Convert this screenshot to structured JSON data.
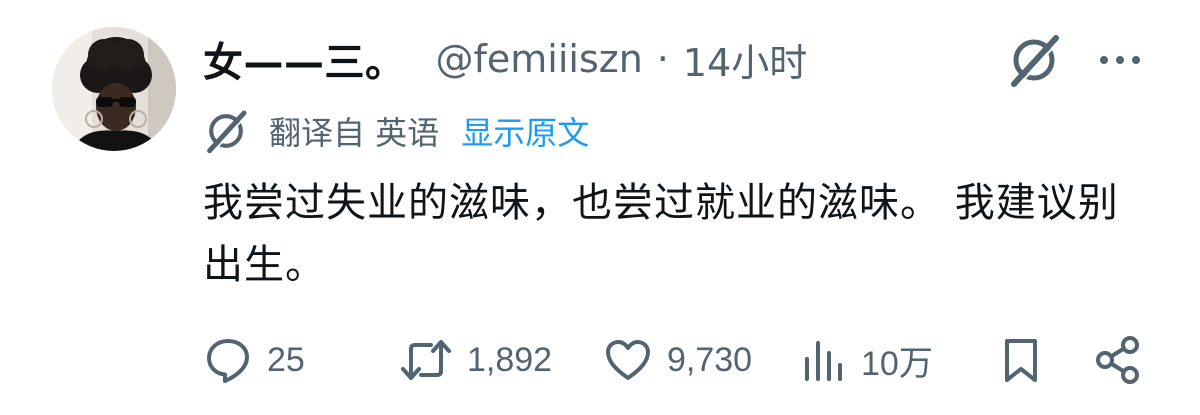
{
  "author": {
    "display_name": "女——三。",
    "handle": "@femiiiszn",
    "separator": "·",
    "time": "14小时"
  },
  "icons": {
    "grok": "grok-icon",
    "more": "more-dots-icon",
    "translate": "grok-translate-icon",
    "reply": "reply-bubble-icon",
    "retweet": "retweet-icon",
    "like": "heart-icon",
    "views": "views-bar-icon",
    "bookmark": "bookmark-icon",
    "share": "share-icon"
  },
  "translation": {
    "label": "翻译自 英语",
    "show_original": "显示原文"
  },
  "tweet": {
    "text": "我尝过失业的滋味，也尝过就业的滋味。 我建议别出生。"
  },
  "metrics": {
    "replies": "25",
    "retweets": "1,892",
    "likes": "9,730",
    "views": "10万"
  },
  "colors": {
    "text": "#0f1419",
    "secondary": "#536471",
    "link": "#1d9bf0",
    "background": "#ffffff"
  }
}
